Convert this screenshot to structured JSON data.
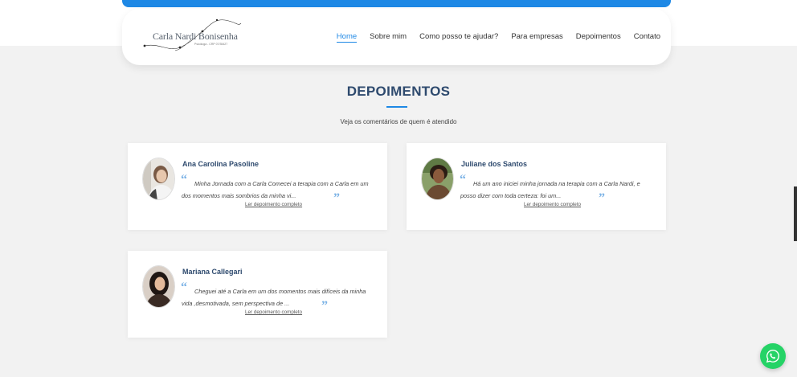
{
  "brand": {
    "name": "Carla Nardi Bonisenha",
    "subtitle": "Psicóloga - CRP 07/35427",
    "logo_icon": "logo-swirl-icon"
  },
  "nav": {
    "items": [
      {
        "label": "Home",
        "active": true
      },
      {
        "label": "Sobre mim",
        "active": false
      },
      {
        "label": "Como posso te ajudar?",
        "active": false
      },
      {
        "label": "Para empresas",
        "active": false
      },
      {
        "label": "Depoimentos",
        "active": false
      },
      {
        "label": "Contato",
        "active": false
      }
    ]
  },
  "section": {
    "title": "DEPOIMENTOS",
    "subtitle": "Veja os comentários de quem é atendido"
  },
  "testimonials": [
    {
      "name": "Ana Carolina Pasoline",
      "text": "Minha Jornada com a Carla Comecei a terapia com a Carla em um dos momentos mais sombrios da minha vi...",
      "link": "Ler depoimento completo"
    },
    {
      "name": "Juliane dos Santos",
      "text": "Há um ano iniciei minha jornada na terapia com a Carla Nardi, e posso dizer com toda certeza: foi um...",
      "link": "Ler depoimento completo"
    },
    {
      "name": "Mariana Callegari",
      "text": "Cheguei até a Carla em um dos momentos mais difíceis da minha vida ,desmotivada, sem perspectiva de ...",
      "link": "Ler depoimento completo"
    }
  ],
  "quote_open": "“",
  "quote_close": "”",
  "whatsapp": {
    "icon": "whatsapp-icon",
    "color": "#25d366"
  },
  "colors": {
    "accent": "#1e88e5",
    "heading": "#2e4a6e",
    "quote": "#7cb3e6"
  }
}
